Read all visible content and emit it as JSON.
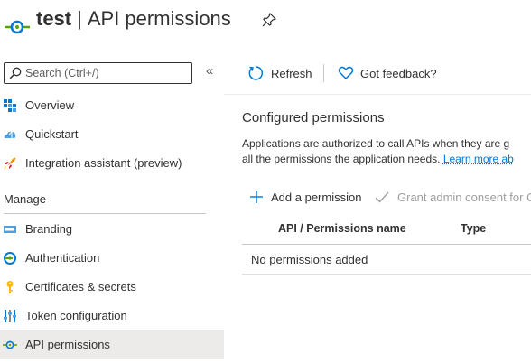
{
  "header": {
    "app_name": "test",
    "separator": "|",
    "page_name": "API permissions"
  },
  "sidebar": {
    "search_placeholder": "Search (Ctrl+/)",
    "collapse_glyph": "«",
    "items": [
      {
        "label": "Overview",
        "icon": "overview-icon"
      },
      {
        "label": "Quickstart",
        "icon": "quickstart-icon"
      },
      {
        "label": "Integration assistant (preview)",
        "icon": "rocket-icon"
      }
    ],
    "section": "Manage",
    "manage_items": [
      {
        "label": "Branding",
        "icon": "branding-icon"
      },
      {
        "label": "Authentication",
        "icon": "authentication-icon"
      },
      {
        "label": "Certificates & secrets",
        "icon": "key-icon"
      },
      {
        "label": "Token configuration",
        "icon": "token-config-icon"
      },
      {
        "label": "API permissions",
        "icon": "api-permissions-icon",
        "active": true
      }
    ]
  },
  "toolbar": {
    "refresh_label": "Refresh",
    "feedback_label": "Got feedback?"
  },
  "main": {
    "heading": "Configured permissions",
    "description_line1": "Applications are authorized to call APIs when they are g",
    "description_line2": "all the permissions the application needs.",
    "learn_more": "Learn more ab",
    "add_permission": "Add a permission",
    "grant_consent": "Grant admin consent for C",
    "columns": [
      "API / Permissions name",
      "Type"
    ],
    "empty_message": "No permissions added"
  },
  "colors": {
    "accent": "#0078d4",
    "active_bg": "#edebe9",
    "api_icon_green": "#57a300"
  }
}
